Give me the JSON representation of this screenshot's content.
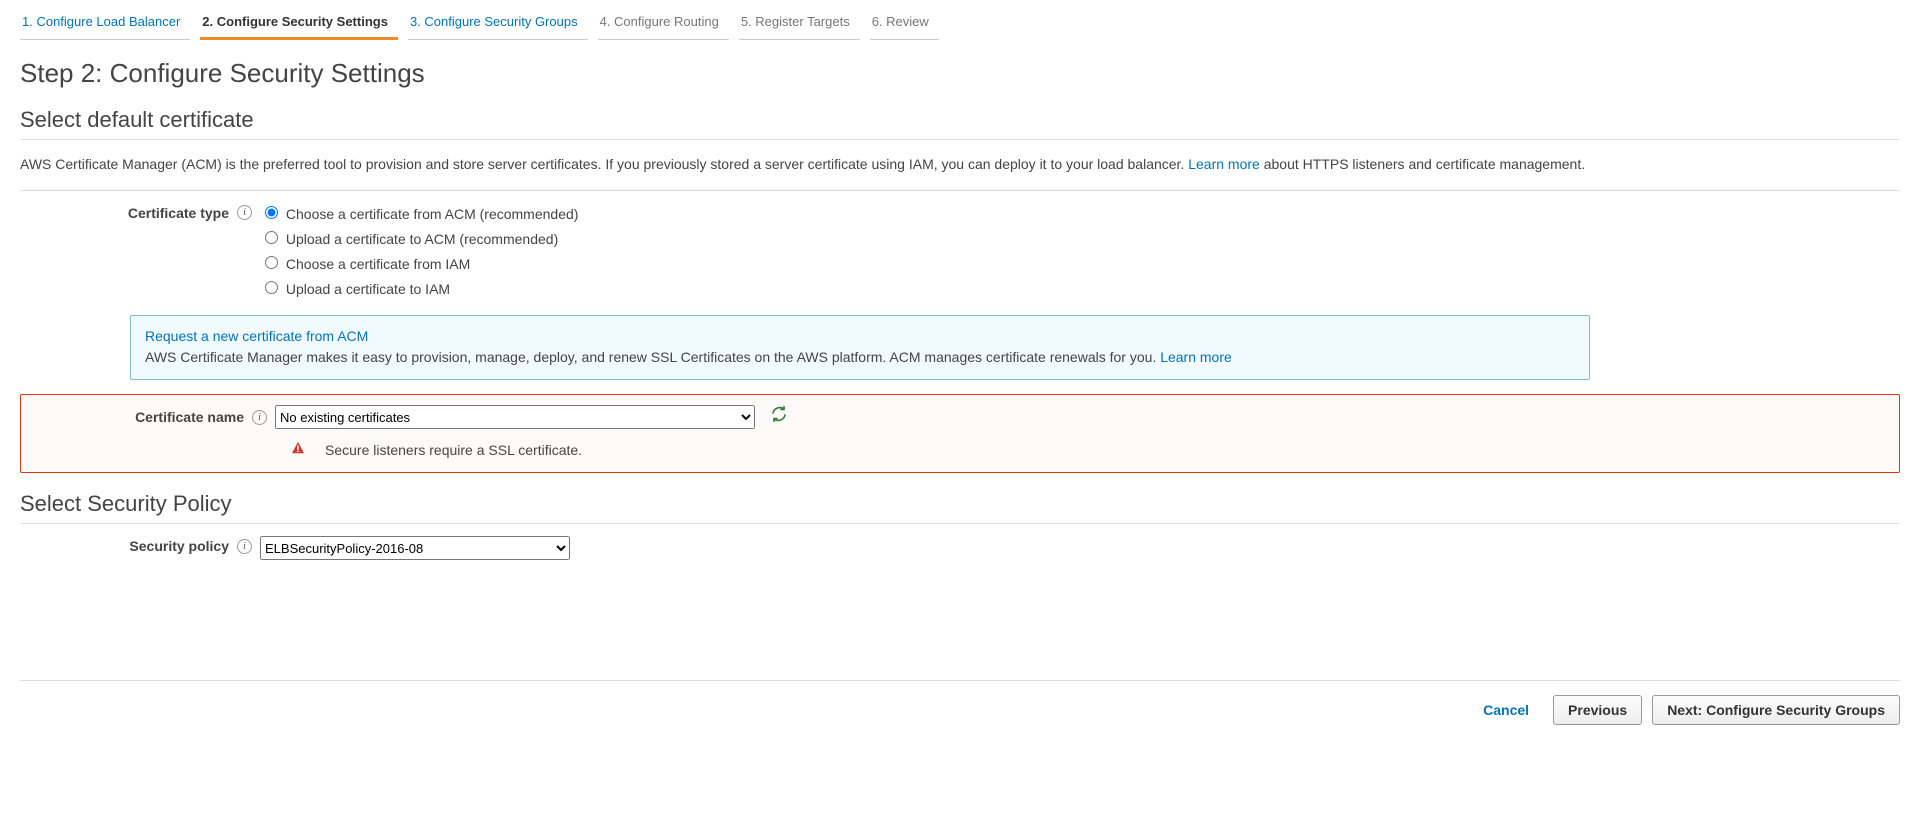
{
  "wizard": {
    "steps": [
      {
        "label": "1. Configure Load Balancer",
        "state": "link"
      },
      {
        "label": "2. Configure Security Settings",
        "state": "active"
      },
      {
        "label": "3. Configure Security Groups",
        "state": "link"
      },
      {
        "label": "4. Configure Routing",
        "state": "disabled"
      },
      {
        "label": "5. Register Targets",
        "state": "disabled"
      },
      {
        "label": "6. Review",
        "state": "disabled"
      }
    ]
  },
  "page_title": "Step 2: Configure Security Settings",
  "section_cert": {
    "title": "Select default certificate",
    "intro_a": "AWS Certificate Manager (ACM) is the preferred tool to provision and store server certificates. If you previously stored a server certificate using IAM, you can deploy it to your load balancer. ",
    "learn_more": "Learn more",
    "intro_b": " about HTTPS listeners and certificate management.",
    "cert_type_label": "Certificate type",
    "radios": [
      "Choose a certificate from ACM (recommended)",
      "Upload a certificate to ACM (recommended)",
      "Choose a certificate from IAM",
      "Upload a certificate to IAM"
    ],
    "info_box": {
      "link": "Request a new certificate from ACM",
      "text": "AWS Certificate Manager makes it easy to provision, manage, deploy, and renew SSL Certificates on the AWS platform. ACM manages certificate renewals for you. ",
      "learn_more": "Learn more"
    },
    "cert_name_label": "Certificate name",
    "cert_name_select": "No existing certificates",
    "error_msg": "Secure listeners require a SSL certificate."
  },
  "section_policy": {
    "title": "Select Security Policy",
    "label": "Security policy",
    "value": "ELBSecurityPolicy-2016-08"
  },
  "buttons": {
    "cancel": "Cancel",
    "previous": "Previous",
    "next": "Next: Configure Security Groups"
  }
}
